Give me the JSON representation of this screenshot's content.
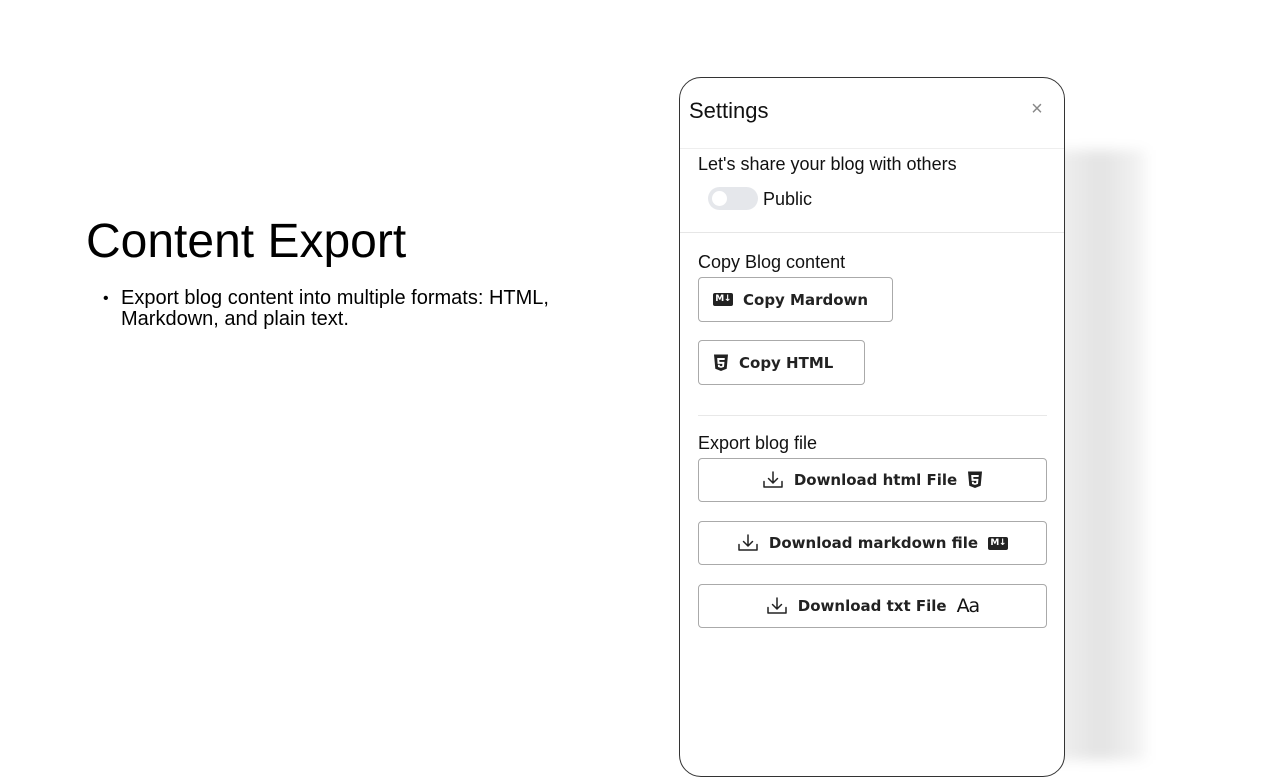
{
  "slide": {
    "title": "Content Export",
    "bullets": [
      "Export blog content into multiple formats: HTML, Markdown, and plain text."
    ]
  },
  "settings": {
    "title": "Settings",
    "close_icon": "×",
    "share": {
      "label": "Let's share your blog with others",
      "toggle_label": "Public",
      "toggle_on": false
    },
    "copy": {
      "label": "Copy Blog content",
      "markdown_button": "Copy Mardown",
      "html_button": "Copy HTML"
    },
    "export": {
      "label": "Export blog file",
      "html_button": "Download html File",
      "markdown_button": "Download markdown file",
      "txt_button": "Download txt File"
    },
    "icons": {
      "markdown": "M↓",
      "text": "Aa",
      "download": "download-icon",
      "html5": "html5-icon"
    },
    "colors": {
      "toggle_off": "#e5e7eb",
      "border": "#aaaaaa",
      "panel_border": "#333333"
    }
  }
}
